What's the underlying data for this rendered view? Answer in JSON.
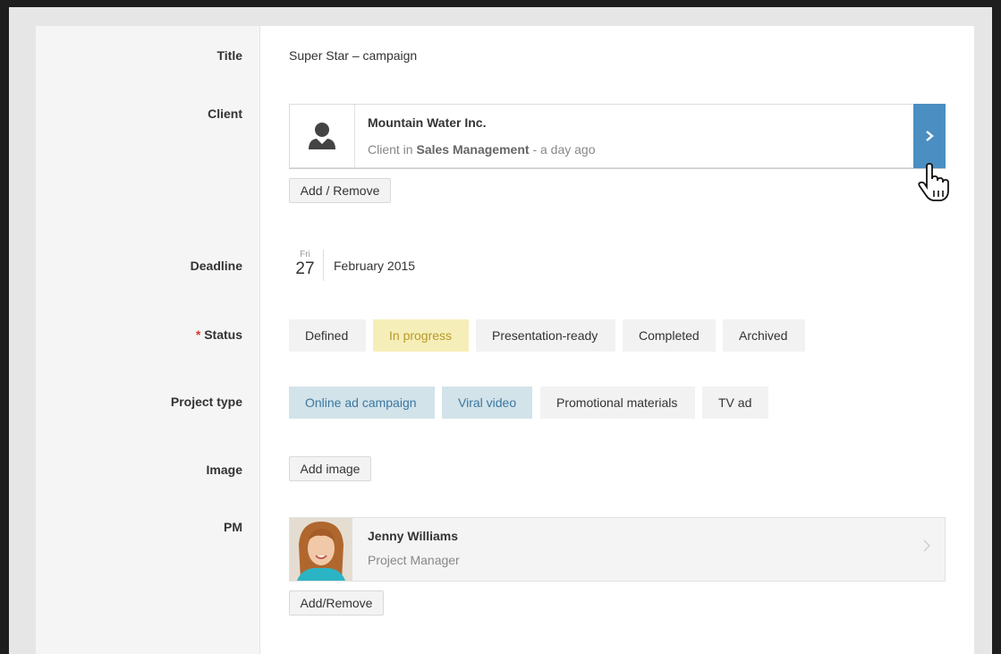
{
  "form": {
    "labels": {
      "title": "Title",
      "client": "Client",
      "deadline": "Deadline",
      "status_req": "*",
      "status": "Status",
      "project_type": "Project type",
      "image": "Image",
      "pm": "PM"
    },
    "title_value": "Super Star – campaign",
    "client": {
      "name": "Mountain Water Inc.",
      "meta_prefix": "Client in",
      "meta_group": "Sales Management",
      "meta_suffix": "- a day ago",
      "avatar_icon": "person-silhouette-icon",
      "arrow_icon": "chevron-right-icon",
      "accent_color": "#4a8ec2"
    },
    "client_button": "Add / Remove",
    "deadline": {
      "day_of_week": "Fri",
      "day": "27",
      "month_year": "February 2015"
    },
    "status_options": [
      {
        "label": "Defined",
        "selected": false
      },
      {
        "label": "In progress",
        "selected": true
      },
      {
        "label": "Presentation-ready",
        "selected": false
      },
      {
        "label": "Completed",
        "selected": false
      },
      {
        "label": "Archived",
        "selected": false
      }
    ],
    "project_type_options": [
      {
        "label": "Online ad campaign",
        "selected": true
      },
      {
        "label": "Viral video",
        "selected": true
      },
      {
        "label": "Promotional materials",
        "selected": false
      },
      {
        "label": "TV ad",
        "selected": false
      }
    ],
    "image_button": "Add image",
    "pm": {
      "name": "Jenny Williams",
      "role": "Project Manager",
      "arrow_icon": "chevron-right-icon"
    },
    "pm_button": "Add/Remove"
  },
  "colors": {
    "status_selected": "#f6eeb8",
    "type_selected": "#d3e3ea"
  },
  "cursor_icon": "hand-pointer-icon"
}
